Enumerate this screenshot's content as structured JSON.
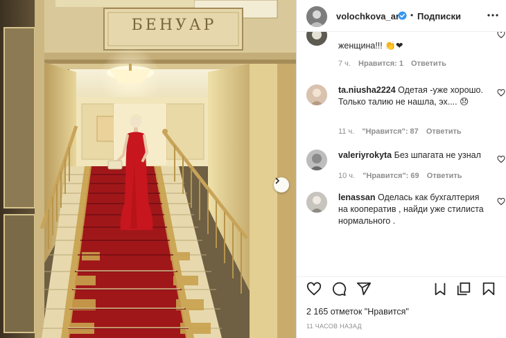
{
  "post": {
    "sign_text": "БЕНУАР"
  },
  "header": {
    "username": "volochkova_art",
    "separator": "•",
    "follow_label": "Подписки"
  },
  "comments": [
    {
      "username": "",
      "text": "женщина!!!",
      "emoji": "👏❤",
      "age": "7 ч.",
      "likes": "Нравится: 1",
      "reply": "Ответить"
    },
    {
      "username": "ta.niusha2224",
      "text": "Одетая -уже хорошо. Только талию не нашла, эх....",
      "emoji": "😞",
      "age": "11 ч.",
      "likes": "\"Нравится\": 87",
      "reply": "Ответить"
    },
    {
      "username": "valeriyrokyta",
      "text": "Без шпагата не узнал",
      "emoji": "",
      "age": "10 ч.",
      "likes": "\"Нравится\": 69",
      "reply": "Ответить"
    },
    {
      "username": "lenassan",
      "text": "Оделась как бухгалтерия на кооператив , найди уже стилиста нормального .",
      "emoji": "",
      "age": "",
      "likes": "",
      "reply": ""
    }
  ],
  "footer": {
    "likes_text": "2 165 отметок \"Нравится\"",
    "time_text": "11 часов назад"
  },
  "icons": {
    "like": "heart-icon",
    "comment": "comment-bubble-icon",
    "share": "paper-plane-icon",
    "save": "bookmark-icon",
    "more": "more-icon",
    "verified": "verified-badge-icon",
    "next": "chevron-right-icon",
    "multi": "multiple-media-icon",
    "collab": "tag-people-icon"
  },
  "colors": {
    "verified": "#3897f0",
    "text": "#262626",
    "secondary": "#8e8e8e",
    "dress": "#c8161e",
    "carpet": "#a0171a"
  }
}
